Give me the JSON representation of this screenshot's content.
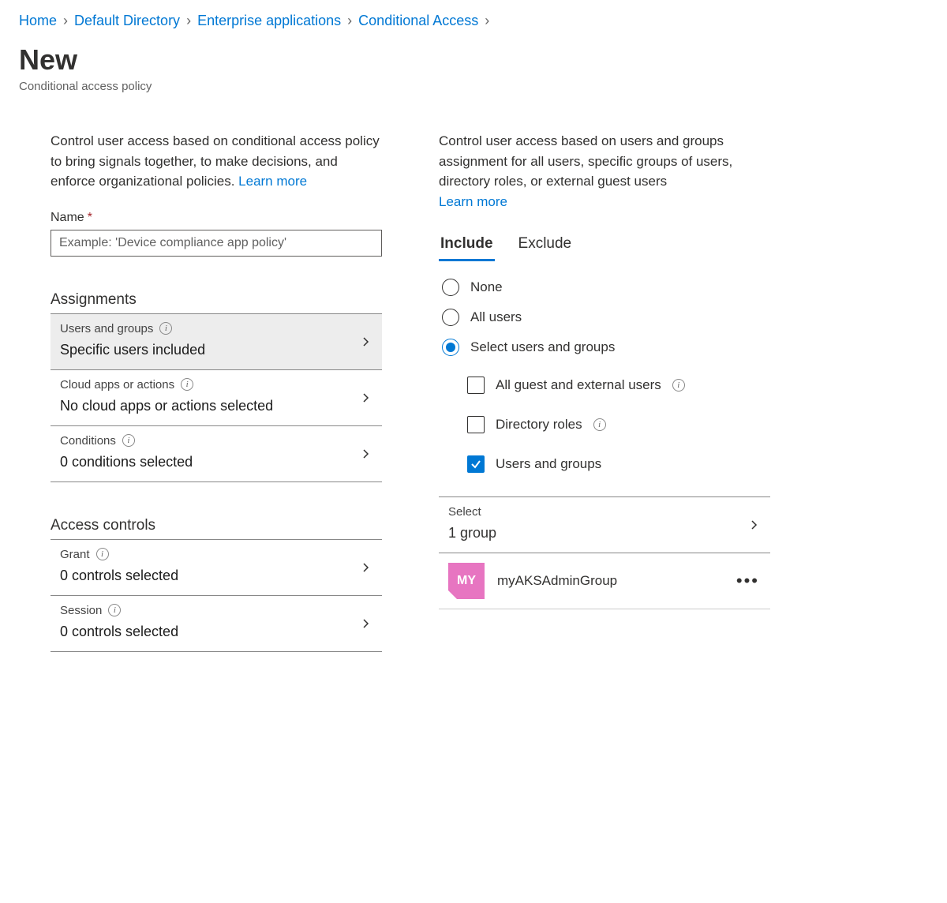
{
  "breadcrumb": {
    "items": [
      "Home",
      "Default Directory",
      "Enterprise applications",
      "Conditional Access"
    ]
  },
  "header": {
    "title": "New",
    "subtitle": "Conditional access policy"
  },
  "left": {
    "description": "Control user access based on conditional access policy to bring signals together, to make decisions, and enforce organizational policies. ",
    "learn_more": "Learn more",
    "name_label": "Name",
    "name_placeholder": "Example: 'Device compliance app policy'",
    "assignments_heading": "Assignments",
    "items": [
      {
        "label": "Users and groups",
        "summary": "Specific users included"
      },
      {
        "label": "Cloud apps or actions",
        "summary": "No cloud apps or actions selected"
      },
      {
        "label": "Conditions",
        "summary": "0 conditions selected"
      }
    ],
    "controls_heading": "Access controls",
    "controls": [
      {
        "label": "Grant",
        "summary": "0 controls selected"
      },
      {
        "label": "Session",
        "summary": "0 controls selected"
      }
    ]
  },
  "right": {
    "description": "Control user access based on users and groups assignment for all users, specific groups of users, directory roles, or external guest users ",
    "learn_more": "Learn more",
    "tabs": {
      "include": "Include",
      "exclude": "Exclude"
    },
    "radios": {
      "none": "None",
      "all_users": "All users",
      "select": "Select users and groups"
    },
    "checks": {
      "guest": "All guest and external users",
      "roles": "Directory roles",
      "users_groups": "Users and groups"
    },
    "select_block": {
      "label": "Select",
      "summary": "1 group"
    },
    "entity": {
      "initials": "MY",
      "name": "myAKSAdminGroup"
    }
  }
}
